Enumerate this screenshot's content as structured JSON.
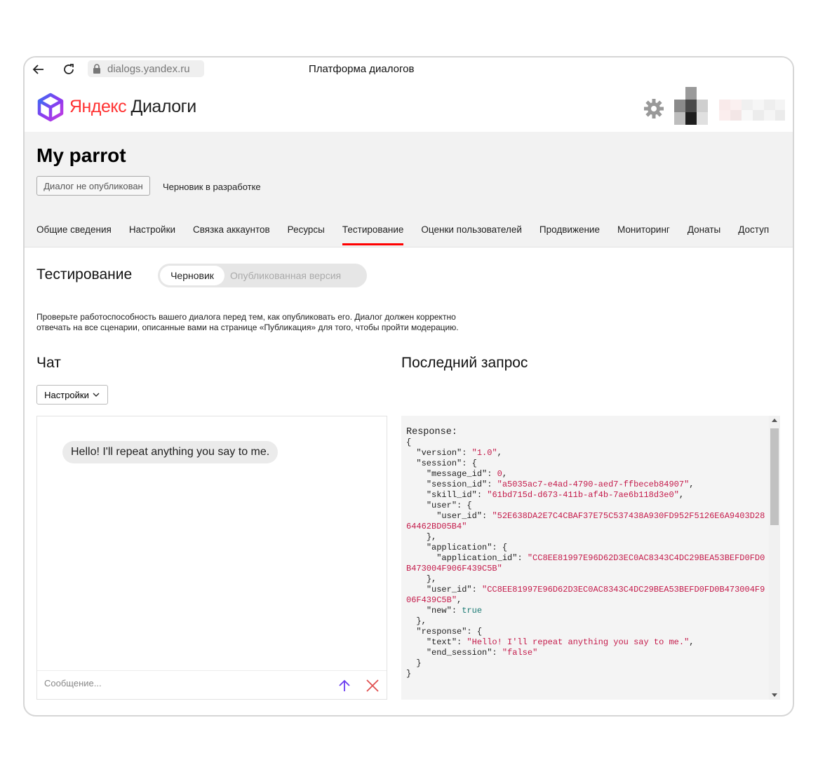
{
  "browser": {
    "url": "dialogs.yandex.ru",
    "page_title": "Платформа диалогов",
    "icons": [
      "back-arrow-icon",
      "reload-icon",
      "lock-icon"
    ]
  },
  "header": {
    "logo_part1": "Яндекс",
    "logo_part2": "Диалоги",
    "icons": [
      "cube-logo-icon",
      "gear-icon",
      "avatar"
    ]
  },
  "project": {
    "title": "My parrot",
    "status_button": "Диалог не опубликован",
    "draft_label": "Черновик в разработке"
  },
  "tabs": [
    {
      "label": "Общие сведения",
      "active": false
    },
    {
      "label": "Настройки",
      "active": false
    },
    {
      "label": "Связка аккаунтов",
      "active": false
    },
    {
      "label": "Ресурсы",
      "active": false
    },
    {
      "label": "Тестирование",
      "active": true
    },
    {
      "label": "Оценки пользователей",
      "active": false
    },
    {
      "label": "Продвижение",
      "active": false
    },
    {
      "label": "Мониторинг",
      "active": false
    },
    {
      "label": "Донаты",
      "active": false
    },
    {
      "label": "Доступ",
      "active": false
    }
  ],
  "testing": {
    "title": "Тестирование",
    "mode_draft": "Черновик",
    "mode_published": "Опубликованная версия",
    "intro_line1": "Проверьте работоспособность вашего диалога перед тем, как опубликовать его. Диалог должен корректно",
    "intro_line2": "отвечать на все сценарии, описанные вами на странице «Публикация» для того, чтобы пройти модерацию."
  },
  "chat": {
    "title": "Чат",
    "settings_button": "Настройки",
    "message": "Hello! I'll repeat anything you say to me.",
    "input_placeholder": "Сообщение..."
  },
  "last_request": {
    "title": "Последний запрос",
    "label": "Response:",
    "version": "1.0",
    "message_id": "0",
    "session_id": "a5035ac7-e4ad-4790-aed7-ffbeceb84907",
    "skill_id": "61bd715d-d673-411b-af4b-7ae6b118d3e0",
    "session_user_id": "52E638DA2E7C4CBAF37E75C537438A930FD952F5126E6A9403D2864462BD05B4",
    "application_id": "CC8EE81997E96D62D3EC0AC8343C4DC29BEA53BEFD0FD0B473004F906F439C5B",
    "user_id": "CC8EE81997E96D62D3EC0AC8343C4DC29BEA53BEFD0FD0B473004F906F439C5B",
    "new": "true",
    "response_text": "Hello! I'll repeat anything you say to me.",
    "end_session": "false"
  },
  "colors": {
    "accent_red": "#ff0000",
    "json_string": "#c41a4a",
    "json_keyword": "#1a7a73",
    "send_icon": "#6b3cf0"
  }
}
